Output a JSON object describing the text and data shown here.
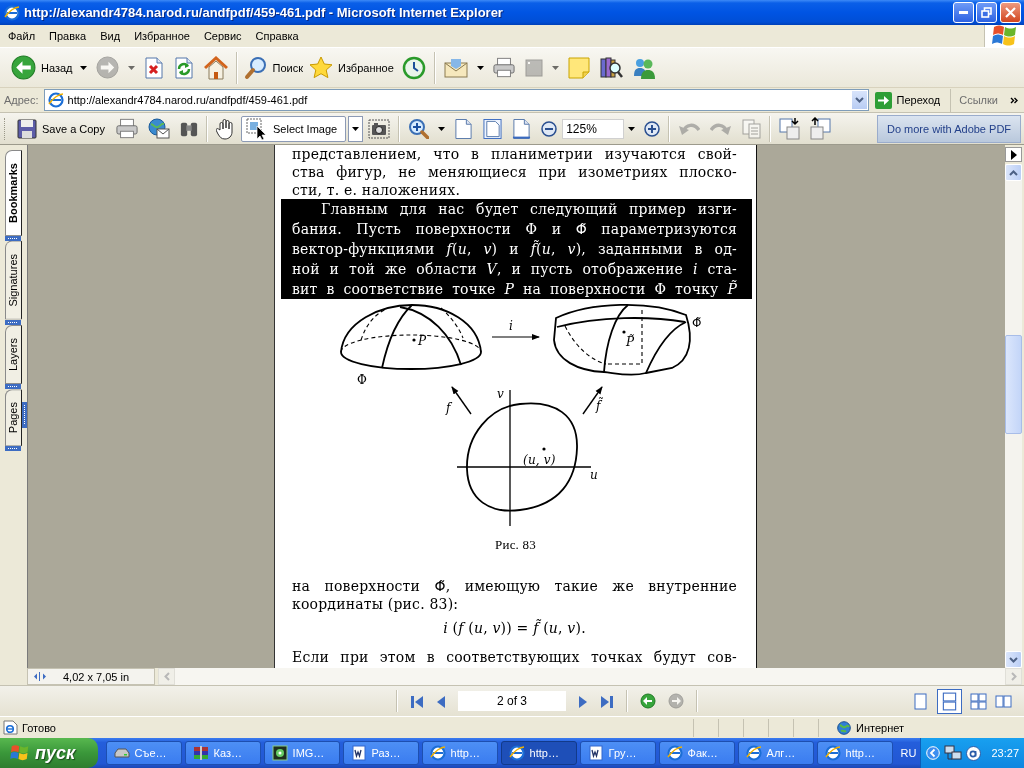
{
  "window": {
    "title": "http://alexandr4784.narod.ru/andfpdf/459-461.pdf - Microsoft Internet Explorer"
  },
  "menu": [
    "Файл",
    "Правка",
    "Вид",
    "Избранное",
    "Сервис",
    "Справка"
  ],
  "toolbar": {
    "groups": [
      [
        {
          "kind": "back",
          "label": "Назад",
          "dropdown": true,
          "disabled": false
        },
        {
          "kind": "forward",
          "dropdown": true,
          "disabled": true
        },
        {
          "kind": "stop",
          "disabled": false
        },
        {
          "kind": "refresh",
          "disabled": false
        },
        {
          "kind": "home",
          "disabled": false
        }
      ],
      [
        {
          "kind": "search",
          "label": "Поиск",
          "disabled": false
        },
        {
          "kind": "favorites",
          "label": "Избранное",
          "disabled": false
        },
        {
          "kind": "history",
          "disabled": false
        }
      ],
      [
        {
          "kind": "mail",
          "dropdown": true,
          "disabled": false
        },
        {
          "kind": "print",
          "disabled": false
        },
        {
          "kind": "edit",
          "dropdown": true,
          "disabled": true
        },
        {
          "kind": "note",
          "disabled": false
        },
        {
          "kind": "research",
          "disabled": false
        },
        {
          "kind": "messenger",
          "disabled": false
        }
      ]
    ]
  },
  "address_bar": {
    "label": "Адрес:",
    "value": "http://alexandr4784.narod.ru/andfpdf/459-461.pdf",
    "go": "Переход",
    "links": "Ссылки"
  },
  "reader_toolbar": {
    "groups": [
      [
        {
          "kind": "save",
          "label": "Save a Copy",
          "disabled": false
        },
        {
          "kind": "print",
          "disabled": false
        },
        {
          "kind": "email",
          "disabled": false
        },
        {
          "kind": "find",
          "disabled": false
        }
      ],
      [
        {
          "kind": "hand",
          "selected": false,
          "disabled": false
        },
        {
          "kind": "select",
          "label": "Select Image",
          "dropdown": true,
          "selected": true,
          "disabled": false
        },
        {
          "kind": "snapshot",
          "selected": false,
          "disabled": false
        }
      ],
      [
        {
          "kind": "zoom",
          "dropdown": true,
          "disabled": false
        },
        {
          "kind": "actual_size",
          "disabled": false
        },
        {
          "kind": "fit_page",
          "disabled": false
        },
        {
          "kind": "fit_width",
          "disabled": false
        },
        {
          "kind": "zoom_out",
          "disabled": false
        },
        {
          "kind": "zoom_value",
          "value": "125%",
          "dropdown": true,
          "disabled": false
        },
        {
          "kind": "zoom_in",
          "disabled": false
        }
      ],
      [
        {
          "kind": "undo",
          "disabled": true
        },
        {
          "kind": "redo",
          "disabled": true
        },
        {
          "kind": "copy",
          "disabled": true
        }
      ],
      [
        {
          "kind": "page_down",
          "disabled": false
        },
        {
          "kind": "page_up",
          "disabled": false
        }
      ]
    ],
    "promo": "Do more with Adobe PDF"
  },
  "nav_tabs": [
    {
      "label": "Bookmarks",
      "selected": true
    },
    {
      "label": "Signatures",
      "selected": false
    },
    {
      "label": "Layers",
      "selected": false
    },
    {
      "label": "Pages",
      "selected": false
    }
  ],
  "page": {
    "blocks": [
      {
        "kind": "text",
        "selected": false,
        "indent": false,
        "ends_paragraph": true,
        "lines": [
          "представлением, что в планиметрии изучаются свой-",
          "ства фигур, не меняющиеся при изометриях плоско-",
          "сти, т. е. наложениях."
        ]
      },
      {
        "kind": "text",
        "selected": true,
        "indent": true,
        "ends_paragraph": false,
        "lines": [
          "Главным для нас будет следующий пример изги-",
          "бания. Пусть поверхности Φ и Φ̃ параметризуются",
          "вектор-функциями *f*(*u*, *v*) и *f̃*(*u*, *v*), заданными в од-",
          "ной и той же области *V*, и пусть отображение *i* ста-",
          "вит в соответствие точке *P* на поверхности Φ точку *P̃*"
        ]
      },
      {
        "kind": "figure",
        "selected": false,
        "labels": {
          "map": "i",
          "surface": "Φ",
          "bent_surface": "Φ̃",
          "point": "P",
          "bent_point": "P̃",
          "map_f": "f",
          "map_f_bent": "f̃",
          "axis_v": "v",
          "axis_u": "u",
          "coordinates": "(u, v)"
        },
        "caption": "Рис. 83"
      },
      {
        "kind": "text",
        "selected": false,
        "indent": false,
        "ends_paragraph": true,
        "lines": [
          "на поверхности Φ̃, имеющую такие же внутренние",
          "координаты (рис. 83):"
        ]
      },
      {
        "kind": "formula",
        "selected": false,
        "text": "*i* (*f* (*u*, *v*)) = *f̃* (*u*, *v*)."
      },
      {
        "kind": "text",
        "selected": false,
        "indent": false,
        "ends_paragraph": false,
        "lines": [
          "Если при этом в соответствующих точках будут сов-"
        ]
      }
    ]
  },
  "page_size": "4,02 x 7,05 in",
  "navigation": {
    "before": [
      {
        "kind": "first",
        "disabled": false
      },
      {
        "kind": "previous",
        "disabled": false
      }
    ],
    "page": "2 of 3",
    "after": [
      {
        "kind": "next",
        "disabled": false
      },
      {
        "kind": "last",
        "disabled": false
      }
    ],
    "history": [
      {
        "kind": "back",
        "disabled": false
      },
      {
        "kind": "forward",
        "disabled": true
      }
    ],
    "views": [
      {
        "kind": "single",
        "selected": false
      },
      {
        "kind": "continuous",
        "selected": true
      },
      {
        "kind": "facing",
        "selected": false
      },
      {
        "kind": "continuous_facing",
        "selected": false
      }
    ]
  },
  "status_bar": {
    "text": "Готово",
    "zone": "Интернет"
  },
  "taskbar": {
    "start": "пуск",
    "tasks": [
      {
        "kind": "drive",
        "label": "Съе…",
        "selected": false
      },
      {
        "kind": "archive",
        "label": "Каз…",
        "selected": false
      },
      {
        "kind": "image",
        "label": "IMG…",
        "selected": false
      },
      {
        "kind": "word",
        "label": "Раз…",
        "selected": false
      },
      {
        "kind": "browser",
        "label": "http…",
        "selected": false
      },
      {
        "kind": "browser",
        "label": "http…",
        "selected": true
      },
      {
        "kind": "word",
        "label": "Гру…",
        "selected": false
      },
      {
        "kind": "browser",
        "label": "Фак…",
        "selected": false
      },
      {
        "kind": "browser",
        "label": "Алг…",
        "selected": false
      },
      {
        "kind": "browser",
        "label": "http…",
        "selected": false
      }
    ],
    "language": "RU",
    "clock": "23:27"
  }
}
